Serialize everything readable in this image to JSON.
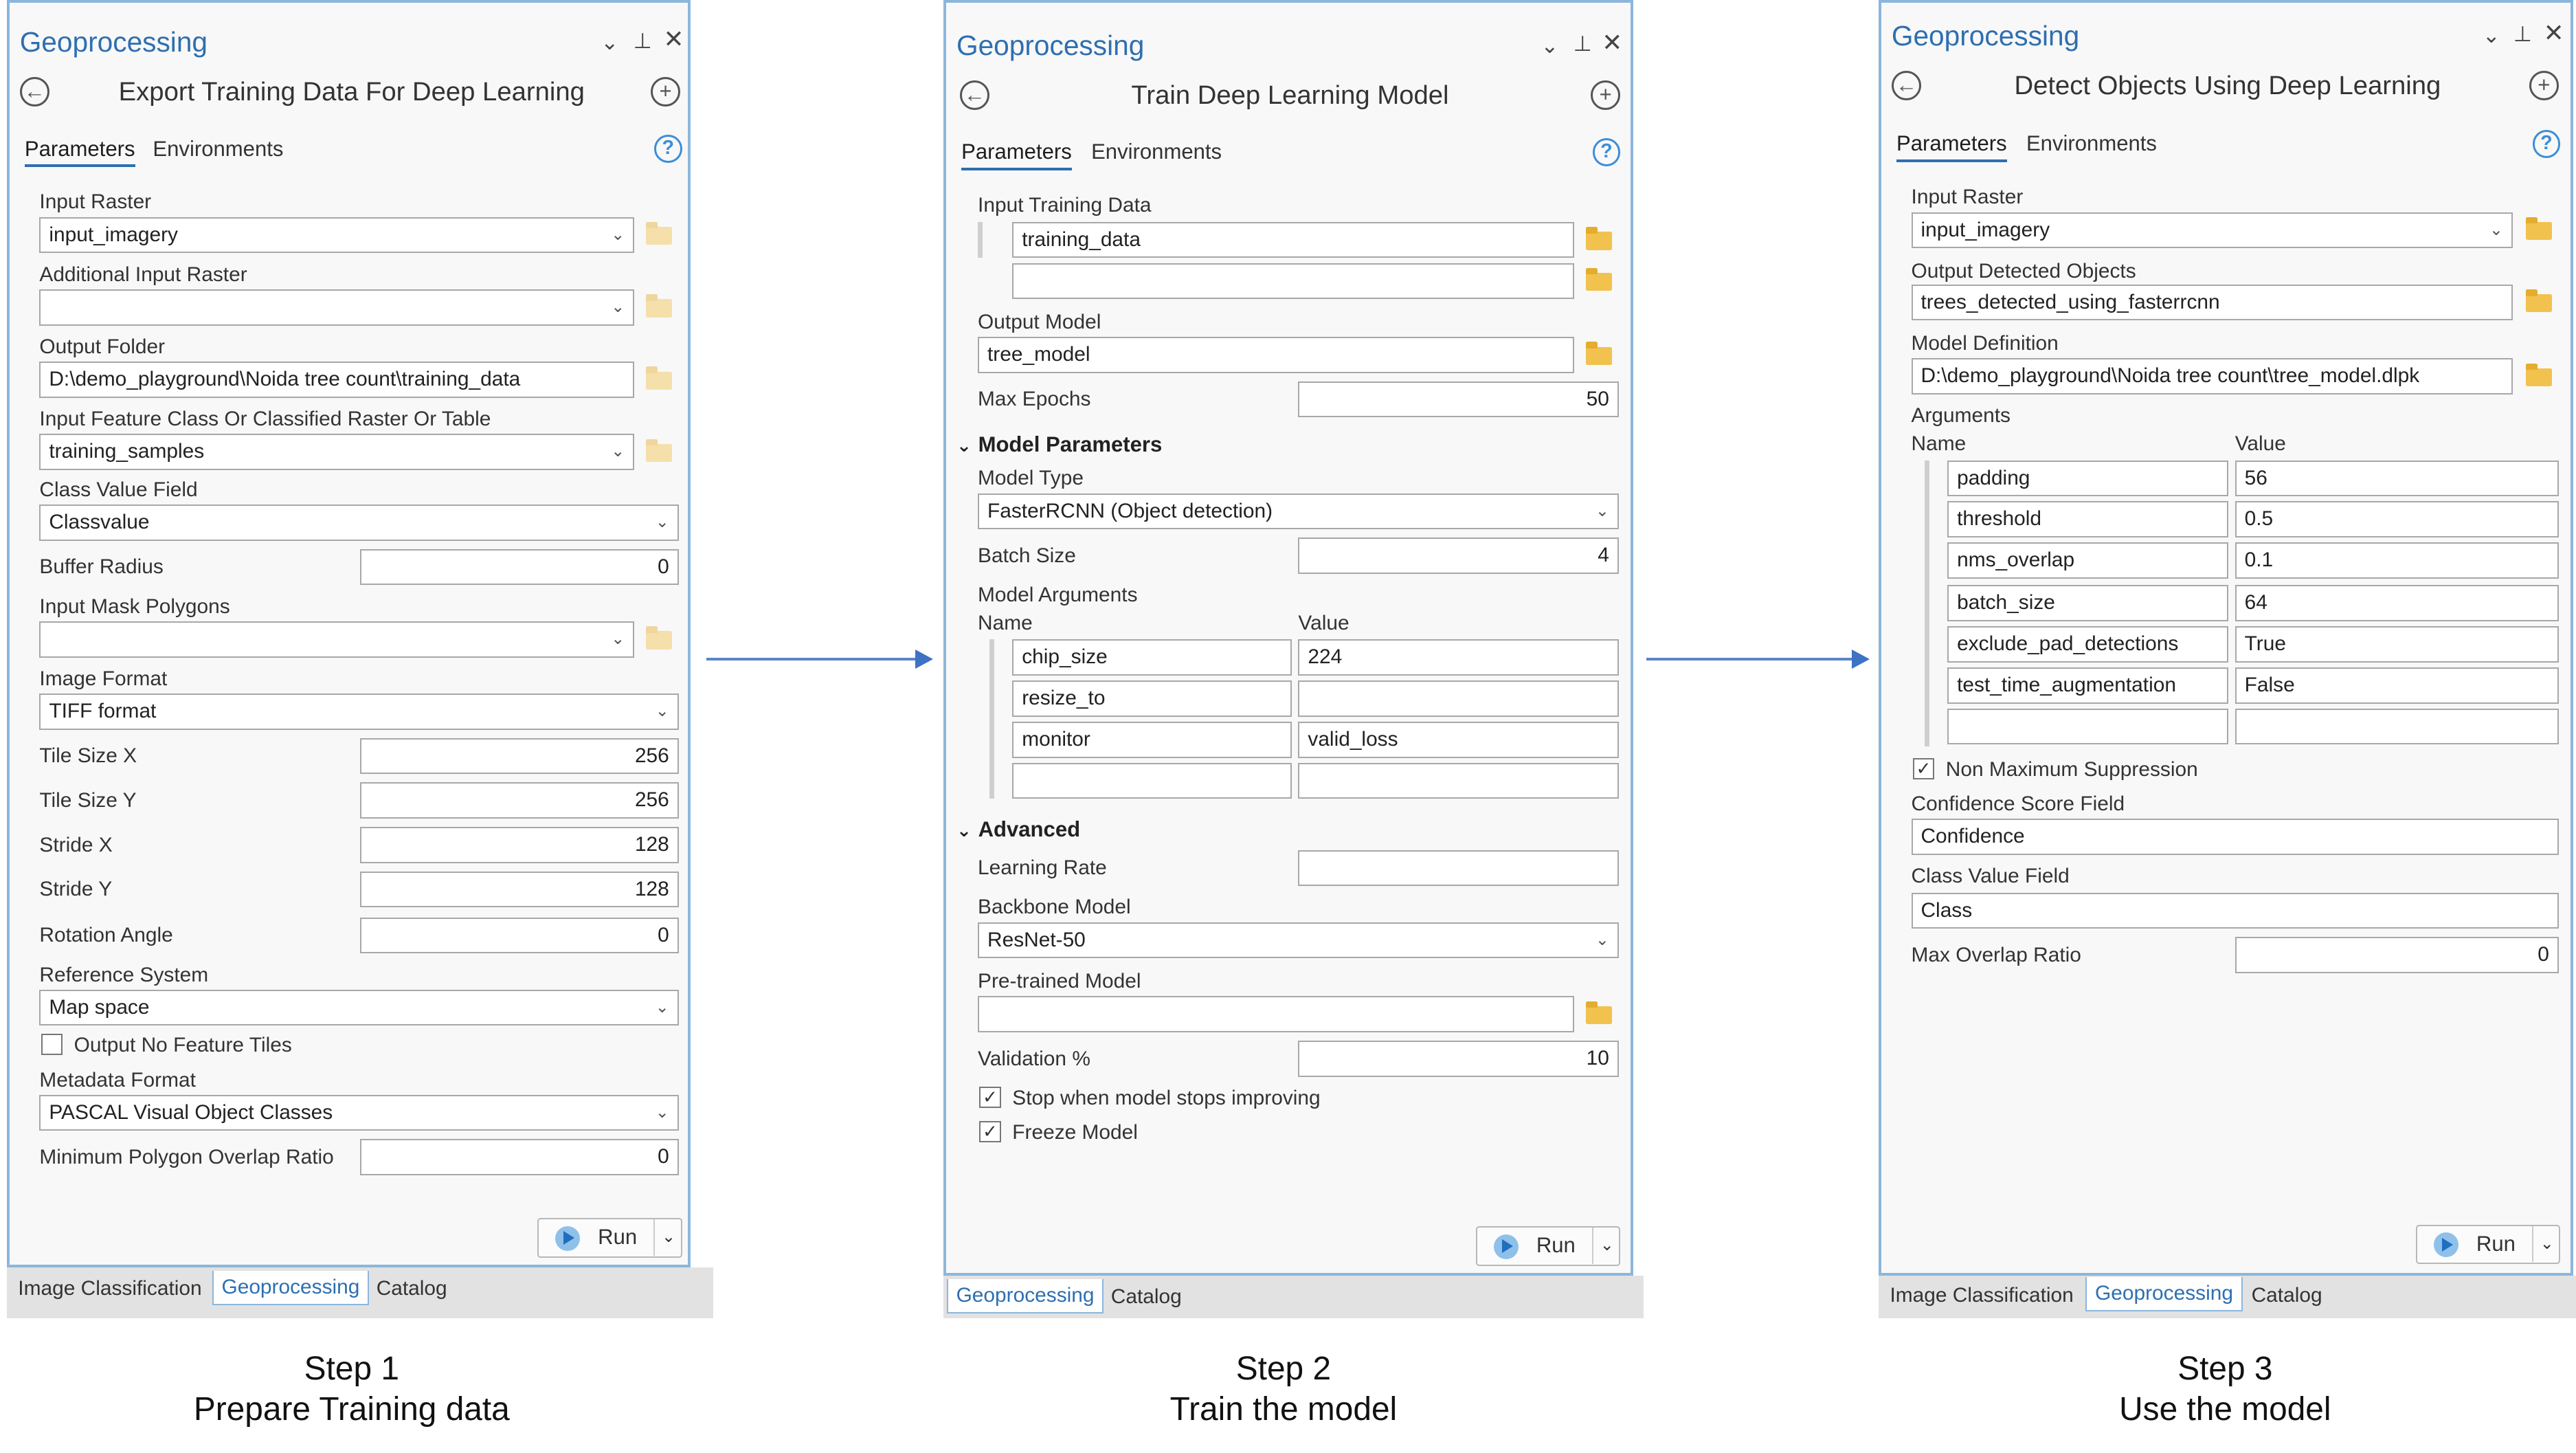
{
  "panel1": {
    "gp_title": "Geoprocessing",
    "tool_title": "Export Training Data For Deep Learning",
    "tab_parameters": "Parameters",
    "tab_environments": "Environments",
    "fields": {
      "input_raster_label": "Input Raster",
      "input_raster_value": "input_imagery",
      "additional_raster_label": "Additional Input Raster",
      "additional_raster_value": "",
      "output_folder_label": "Output Folder",
      "output_folder_value": "D:\\demo_playground\\Noida tree count\\training_data",
      "input_feature_label": "Input Feature Class Or Classified Raster Or Table",
      "input_feature_value": "training_samples",
      "class_value_label": "Class Value Field",
      "class_value_value": "Classvalue",
      "buffer_radius_label": "Buffer Radius",
      "buffer_radius_value": "0",
      "mask_polygons_label": "Input Mask Polygons",
      "mask_polygons_value": "",
      "image_format_label": "Image Format",
      "image_format_value": "TIFF format",
      "tile_x_label": "Tile Size X",
      "tile_x_value": "256",
      "tile_y_label": "Tile Size Y",
      "tile_y_value": "256",
      "stride_x_label": "Stride X",
      "stride_x_value": "128",
      "stride_y_label": "Stride Y",
      "stride_y_value": "128",
      "rotation_label": "Rotation Angle",
      "rotation_value": "0",
      "reference_label": "Reference System",
      "reference_value": "Map space",
      "no_feature_label": "Output No Feature Tiles",
      "no_feature_checked": false,
      "metadata_label": "Metadata Format",
      "metadata_value": "PASCAL Visual Object Classes",
      "min_overlap_label": "Minimum Polygon Overlap Ratio",
      "min_overlap_value": "0"
    },
    "run_label": "Run",
    "bottom_tabs": [
      "Image Classification",
      "Geoprocessing",
      "Catalog"
    ],
    "active_bottom_tab": "Geoprocessing"
  },
  "panel2": {
    "gp_title": "Geoprocessing",
    "tool_title": "Train Deep Learning Model",
    "tab_parameters": "Parameters",
    "tab_environments": "Environments",
    "fields": {
      "training_data_label": "Input Training Data",
      "training_data_value": "training_data",
      "training_data_value2": "",
      "output_model_label": "Output Model",
      "output_model_value": "tree_model",
      "max_epochs_label": "Max Epochs",
      "max_epochs_value": "50",
      "model_params_section": "Model Parameters",
      "model_type_label": "Model Type",
      "model_type_value": "FasterRCNN (Object detection)",
      "batch_size_label": "Batch Size",
      "batch_size_value": "4",
      "model_args_label": "Model Arguments",
      "name_header": "Name",
      "value_header": "Value",
      "args": [
        {
          "name": "chip_size",
          "value": "224"
        },
        {
          "name": "resize_to",
          "value": ""
        },
        {
          "name": "monitor",
          "value": "valid_loss"
        },
        {
          "name": "",
          "value": ""
        }
      ],
      "advanced_section": "Advanced",
      "learning_rate_label": "Learning Rate",
      "learning_rate_value": "",
      "backbone_label": "Backbone Model",
      "backbone_value": "ResNet-50",
      "pretrained_label": "Pre-trained Model",
      "pretrained_value": "",
      "validation_label": "Validation %",
      "validation_value": "10",
      "stop_label": "Stop when model stops improving",
      "stop_checked": true,
      "freeze_label": "Freeze Model",
      "freeze_checked": true
    },
    "run_label": "Run",
    "bottom_tabs": [
      "Geoprocessing",
      "Catalog"
    ],
    "active_bottom_tab": "Geoprocessing"
  },
  "panel3": {
    "gp_title": "Geoprocessing",
    "tool_title": "Detect Objects Using Deep Learning",
    "tab_parameters": "Parameters",
    "tab_environments": "Environments",
    "fields": {
      "input_raster_label": "Input Raster",
      "input_raster_value": "input_imagery",
      "output_detected_label": "Output Detected Objects",
      "output_detected_value": "trees_detected_using_fasterrcnn",
      "model_def_label": "Model Definition",
      "model_def_value": "D:\\demo_playground\\Noida tree count\\tree_model.dlpk",
      "arguments_label": "Arguments",
      "name_header": "Name",
      "value_header": "Value",
      "args": [
        {
          "name": "padding",
          "value": "56"
        },
        {
          "name": "threshold",
          "value": "0.5"
        },
        {
          "name": "nms_overlap",
          "value": "0.1"
        },
        {
          "name": "batch_size",
          "value": "64"
        },
        {
          "name": "exclude_pad_detections",
          "value": "True"
        },
        {
          "name": "test_time_augmentation",
          "value": "False"
        },
        {
          "name": "",
          "value": ""
        }
      ],
      "nms_label": "Non Maximum Suppression",
      "nms_checked": true,
      "confidence_label": "Confidence Score Field",
      "confidence_value": "Confidence",
      "class_value_label": "Class Value Field",
      "class_value_value": "Class",
      "max_overlap_label": "Max Overlap Ratio",
      "max_overlap_value": "0"
    },
    "run_label": "Run",
    "bottom_tabs": [
      "Image Classification",
      "Geoprocessing",
      "Catalog"
    ],
    "active_bottom_tab": "Geoprocessing"
  },
  "steps": [
    {
      "step": "Step 1",
      "caption": "Prepare Training data"
    },
    {
      "step": "Step 2",
      "caption": "Train the model"
    },
    {
      "step": "Step 3",
      "caption": "Use the model"
    }
  ],
  "icons": [
    "back-icon",
    "add-icon",
    "help-icon",
    "pin-icon",
    "close-icon",
    "menu-chevron-icon",
    "folder-icon",
    "dropdown-arrow-icon",
    "run-icon",
    "checkbox-icon",
    "section-collapse-icon",
    "flow-arrow-icon"
  ],
  "colors": {
    "accent": "#2e6fb0",
    "pane_border": "#8cb6dc",
    "arrow": "#3e72c4",
    "folder": "#f2c24f"
  }
}
